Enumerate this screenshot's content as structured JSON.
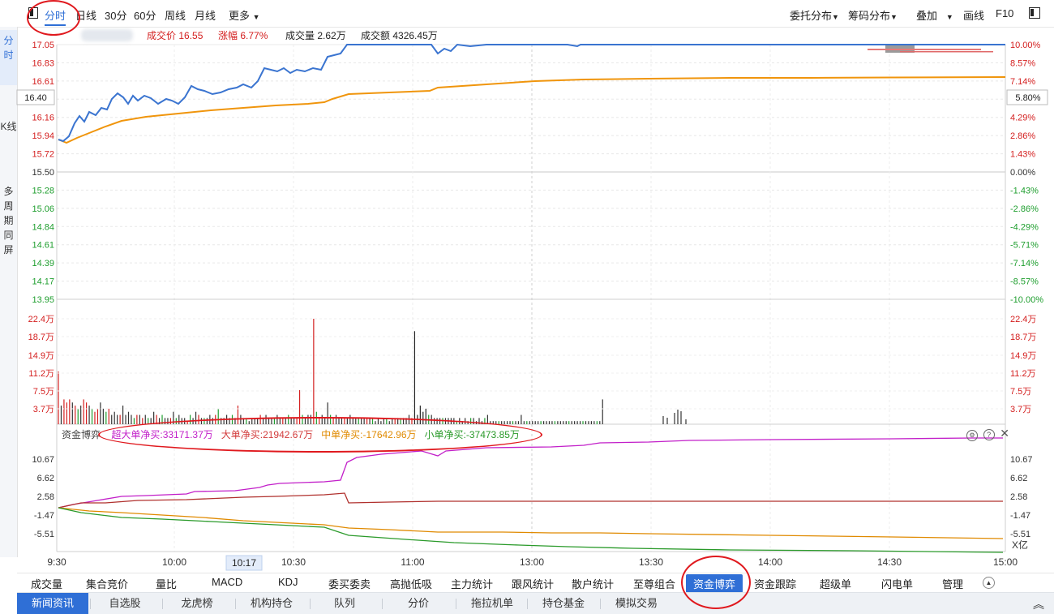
{
  "toolbar": {
    "tabs": [
      "分时",
      "日线",
      "30分",
      "60分",
      "周线",
      "月线",
      "更多"
    ],
    "right": [
      "委托分布",
      "筹码分布",
      "叠加",
      "画线",
      "F10"
    ]
  },
  "leftbar": [
    "分时",
    "K线",
    "多周期同屏"
  ],
  "quote": {
    "price_label": "成交价",
    "price": "16.55",
    "change_label": "涨幅",
    "change": "6.77%",
    "vol_label": "成交量",
    "vol": "2.62万",
    "amount_label": "成交额",
    "amount": "4326.45万"
  },
  "crosshair": {
    "price": "16.40",
    "pct": "5.80%",
    "time": "10:17"
  },
  "price_axis_left": [
    "17.05",
    "16.83",
    "16.61",
    "16.40",
    "16.16",
    "15.94",
    "15.72",
    "15.50",
    "15.28",
    "15.06",
    "14.84",
    "14.61",
    "14.39",
    "14.17",
    "13.95"
  ],
  "price_axis_right": [
    "10.00%",
    "8.57%",
    "7.14%",
    "5.80%",
    "4.29%",
    "2.86%",
    "1.43%",
    "0.00%",
    "-1.43%",
    "-2.86%",
    "-4.29%",
    "-5.71%",
    "-7.14%",
    "-8.57%",
    "-10.00%"
  ],
  "volume_axis": [
    "22.4万",
    "18.7万",
    "14.9万",
    "11.2万",
    "7.5万",
    "3.7万"
  ],
  "fund_panel": {
    "title": "资金博弈",
    "stats": [
      {
        "label": "超大单净买:33171.37万",
        "color": "#c21fc9"
      },
      {
        "label": "大单净买:21942.67万",
        "color": "#d23a3a"
      },
      {
        "label": "中单净买:-17642.96万",
        "color": "#e08a00"
      },
      {
        "label": "小单净买:-37473.85万",
        "color": "#2a9a2a"
      }
    ],
    "axis": [
      "10.67",
      "6.62",
      "2.58",
      "-1.47",
      "-5.51"
    ],
    "unit": "X亿"
  },
  "time_axis": [
    "9:30",
    "10:00",
    "10:30",
    "11:00",
    "13:00",
    "13:30",
    "14:00",
    "14:30",
    "15:00"
  ],
  "indicator_tabs": [
    "成交量",
    "集合竞价",
    "量比",
    "MACD",
    "KDJ",
    "委买委卖",
    "高抛低吸",
    "主力统计",
    "跟风统计",
    "散户统计",
    "至尊组合",
    "资金博弈",
    "资金跟踪",
    "超级单",
    "闪电单",
    "管理"
  ],
  "active_indicator": "资金博弈",
  "news_tabs": [
    "新闻资讯",
    "自选股",
    "龙虎榜",
    "机构持仓",
    "队列",
    "分价",
    "拖拉机单",
    "持仓基金",
    "模拟交易"
  ],
  "colors": {
    "price_line": "#3a74d0",
    "avg_line": "#f0950c",
    "up": "#d42020",
    "down": "#1e9e2e",
    "accent": "#2f6fd6"
  }
}
